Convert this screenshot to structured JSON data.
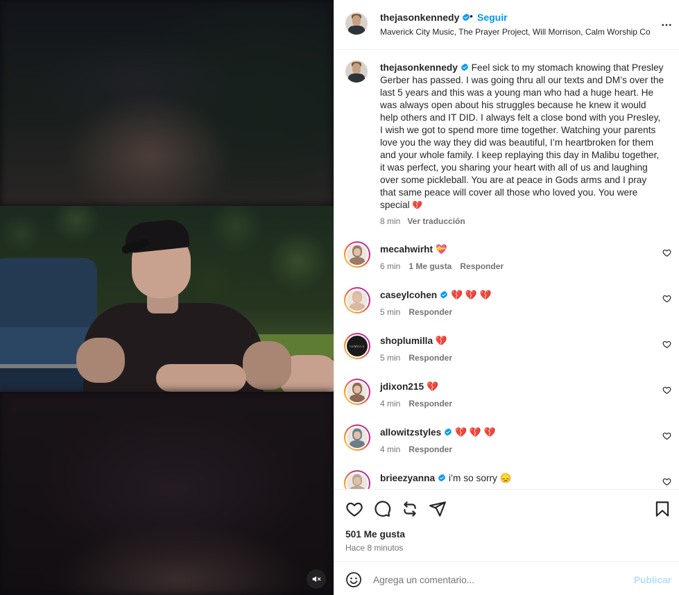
{
  "post": {
    "author": "thejasonkennedy",
    "follow_label": "Seguir",
    "separator": "•",
    "audio": "Maverick City Music, The Prayer Project, Will Morrison, Calm Worship Co",
    "more_icon": "more-horizontal-icon",
    "mute_icon": "speaker-muted-icon",
    "caption": "Feel sick to my stomach knowing that Presley Gerber has passed. I was going thru all our texts and DM’s over the last 5 years and this was a young man who had a huge heart. He was always open about his struggles because he knew it would help others and IT DID. I always felt a close bond with you Presley, I wish we got to spend more time together. Watching your parents love you the way they did was beautiful, I’m heartbroken for them and your whole family. I keep replaying this day in Malibu together, it was perfect, you sharing your heart with all of us and laughing over some pickleball. You are at peace in Gods arms and I pray that same peace will cover all those who loved you. You were special",
    "caption_emoji": "💔",
    "caption_time": "8 min",
    "translate_label": "Ver traducción"
  },
  "comments": [
    {
      "user": "mecahwirht",
      "verified": false,
      "text": "💝",
      "time": "6 min",
      "likes": "1 Me gusta",
      "reply": "Responder",
      "avatar_color": "#9a7a66"
    },
    {
      "user": "caseylcohen",
      "verified": true,
      "text": "💔 💔 💔",
      "time": "5 min",
      "likes": "",
      "reply": "Responder",
      "avatar_color": "#d9b8a0"
    },
    {
      "user": "shoplumilla",
      "verified": false,
      "text": "💔",
      "time": "5 min",
      "likes": "",
      "reply": "Responder",
      "avatar_color": "#1a1a1a",
      "avatar_text": "LUMILLA"
    },
    {
      "user": "jdixon215",
      "verified": false,
      "text": "💔",
      "time": "4 min",
      "likes": "",
      "reply": "Responder",
      "avatar_color": "#8a6a52"
    },
    {
      "user": "allowitzstyles",
      "verified": true,
      "text": "💔 💔 💔",
      "time": "4 min",
      "likes": "",
      "reply": "Responder",
      "avatar_color": "#6e7e88"
    },
    {
      "user": "brieezyanna",
      "verified": true,
      "text": "i’m so sorry 😞",
      "time": "",
      "likes": "",
      "reply": "",
      "avatar_color": "#b8a696"
    }
  ],
  "actions": {
    "like_icon": "heart-icon",
    "comment_icon": "comment-icon",
    "repost_icon": "repost-icon",
    "share_icon": "send-icon",
    "save_icon": "bookmark-icon",
    "likes_count": "501 Me gusta",
    "posted_ago": "Hace 8 minutos"
  },
  "composer": {
    "emoji_icon": "smiley-icon",
    "placeholder": "Agrega un comentario...",
    "publish_label": "Publicar"
  },
  "colors": {
    "link_blue": "#0095f6",
    "publish_disabled": "#b2dffc",
    "secondary_text": "#737373",
    "verified_blue": "#0095f6",
    "broken_heart": "#e0245e"
  }
}
